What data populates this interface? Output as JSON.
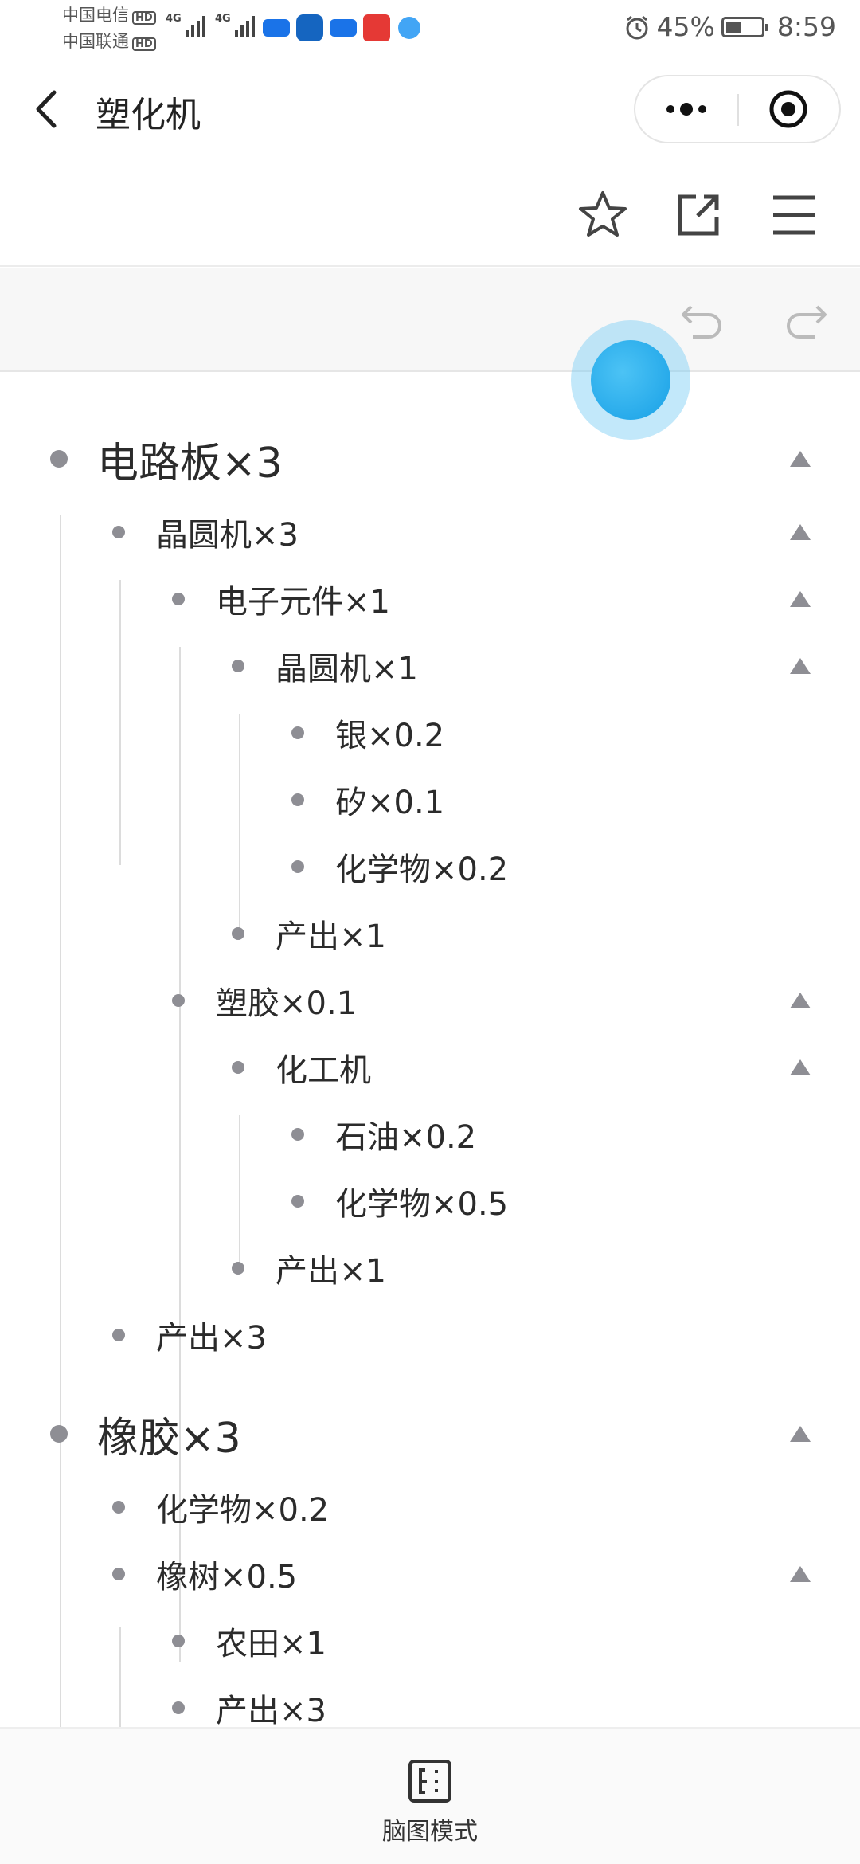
{
  "status_bar": {
    "carrier_1": "中国电信",
    "carrier_2": "中国联通",
    "hd_badge": "HD",
    "network_1": "4G",
    "network_2": "4G",
    "battery_percent": "45%",
    "time": "8:59"
  },
  "header": {
    "title": "塑化机"
  },
  "outline": {
    "items": [
      {
        "label": "电路板×3"
      },
      {
        "label": "晶圆机×3"
      },
      {
        "label": "电子元件×1"
      },
      {
        "label": "晶圆机×1"
      },
      {
        "label": "银×0.2"
      },
      {
        "label": "矽×0.1"
      },
      {
        "label": "化学物×0.2"
      },
      {
        "label": "产出×1"
      },
      {
        "label": "塑胶×0.1"
      },
      {
        "label": "化工机"
      },
      {
        "label": "石油×0.2"
      },
      {
        "label": "化学物×0.5"
      },
      {
        "label": "产出×1"
      },
      {
        "label": "产出×3"
      },
      {
        "label": "橡胶×3"
      },
      {
        "label": "化学物×0.2"
      },
      {
        "label": "橡树×0.5"
      },
      {
        "label": "农田×1"
      },
      {
        "label": "产出×3"
      }
    ]
  },
  "bottom_bar": {
    "mindmap_label": "脑图模式"
  },
  "colors": {
    "bullet": "#8e8e94",
    "guide_line": "#dcdcdc",
    "bubble": "#18a0e6",
    "text": "#2b2b2b"
  },
  "icons": [
    "back-arrow-icon",
    "more-dots-icon",
    "target-close-icon",
    "star-icon",
    "share-icon",
    "menu-icon",
    "undo-icon",
    "redo-icon",
    "mindmap-icon"
  ]
}
